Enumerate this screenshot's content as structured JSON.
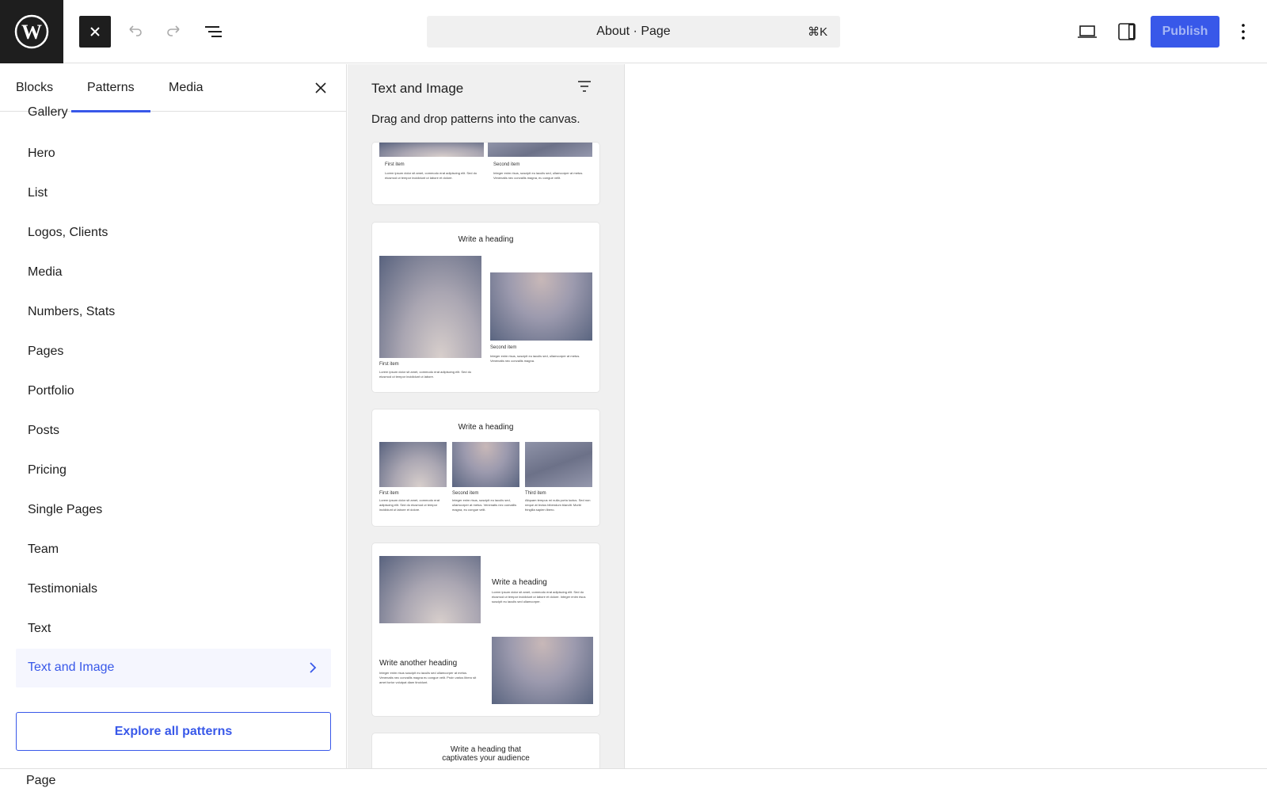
{
  "topbar": {
    "logo": "wordpress-logo",
    "command_bar": {
      "title": "About · Page",
      "shortcut": "⌘K"
    },
    "publish_label": "Publish",
    "colors": {
      "accent": "#3858e9",
      "dark": "#1e1e1e"
    }
  },
  "inserter": {
    "tabs": [
      {
        "label": "Blocks"
      },
      {
        "label": "Patterns"
      },
      {
        "label": "Media"
      }
    ],
    "active_tab": "Patterns",
    "categories": [
      "Gallery",
      "Hero",
      "List",
      "Logos, Clients",
      "Media",
      "Numbers, Stats",
      "Pages",
      "Portfolio",
      "Posts",
      "Pricing",
      "Single Pages",
      "Team",
      "Testimonials",
      "Text"
    ],
    "selected_category": "Text and Image",
    "explore_label": "Explore all patterns"
  },
  "patterns_panel": {
    "title": "Text and Image",
    "description": "Drag and drop patterns into the canvas.",
    "cards": [
      {
        "items": [
          {
            "title": "First item",
            "text": "Lorem ipsum dolor sit amet, commodo erat adipiscing elit. Sed do eiusmod ut tempor incididunt ut labore et dolore."
          },
          {
            "title": "Second item",
            "text": "Integer enim risus, suscipit eu iaculis sed, ullamcorper at metus. Venenatis nec convallis magna, eu congue velit."
          }
        ]
      },
      {
        "heading": "Write a heading",
        "items": [
          {
            "title": "First item",
            "text": "Lorem ipsum dolor sit amet, commodo erat adipiscing elit. Sed do eiusmod ut tempor incididunt ut labore."
          },
          {
            "title": "Second item",
            "text": "Integer enim risus, suscipit eu iaculis sed, ullamcorper at metus. Venenatis nec convallis magna."
          }
        ]
      },
      {
        "heading": "Write a heading",
        "items": [
          {
            "title": "First item",
            "text": "Lorem ipsum dolor sit amet, commodo erat adipiscing elit. Sed do eiusmod ut tempor incididunt ut labore et dolore."
          },
          {
            "title": "Second item",
            "text": "Integer enim risus, suscipit eu iaculis sed, ullamcorper at metus. Venenatis nec convallis magna, eu congue velit."
          },
          {
            "title": "Third item",
            "text": "Aliquam tempus mi nulla porta luctus. Sed non neque at lectus bibendum blandit. Morbi fringilla sapien libero."
          }
        ]
      },
      {
        "heading": "Write a heading",
        "text": "Lorem ipsum dolor sit amet, commodo erat adipiscing elit. Sed do eiusmod ut tempor incididunt ut labore et dolore. Integer enim risus suscipit eu iaculis sed ullamcorper.",
        "heading2": "Write another heading",
        "text2": "Integer enim risus suscipit eu iaculis sed ullamcorper at metus. Venenatis nec convallis magna eu congue velit. Proin varius libero sit amet tortor volutpat diam tincidunt."
      },
      {
        "heading": "Write a heading that captivates your audience"
      }
    ]
  },
  "statusbar": {
    "breadcrumb": "Page"
  }
}
